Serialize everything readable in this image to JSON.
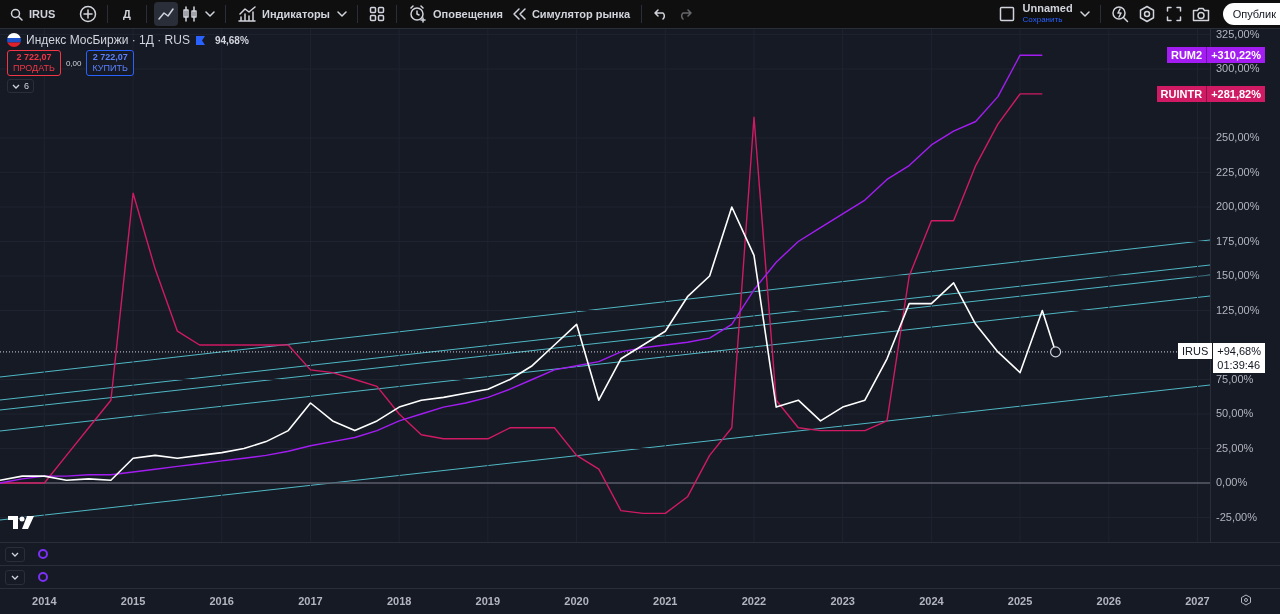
{
  "toolbar": {
    "symbol": "IRUS",
    "interval": "Д",
    "chart_styles": [
      {
        "kind": "line",
        "selected": true
      },
      {
        "kind": "candles",
        "selected": false
      }
    ],
    "buttons": [
      {
        "kind": "indicators",
        "label": "Индикаторы"
      },
      {
        "kind": "templates"
      },
      {
        "kind": "alerts",
        "label": "Оповещения"
      },
      {
        "kind": "replay",
        "label": "Симулятор рынка"
      }
    ],
    "layout": {
      "name": "Unnamed",
      "status": "Сохранить"
    },
    "publish_label": "Опублик"
  },
  "legend": {
    "title": "Индекс МосБиржи · 1Д · RUS",
    "change": "94,68%",
    "sell": {
      "price": "2 722,07",
      "label": "ПРОДАТЬ"
    },
    "spread": "0,00",
    "buy": {
      "price": "2 722,07",
      "label": "КУПИТЬ"
    },
    "indicators_count": "6"
  },
  "chart": {
    "chart_data": {
      "type": "line",
      "x": [
        2013.5,
        2013.75,
        2014,
        2014.25,
        2014.5,
        2014.75,
        2015,
        2015.25,
        2015.5,
        2015.75,
        2016,
        2016.25,
        2016.5,
        2016.75,
        2017,
        2017.25,
        2017.5,
        2017.75,
        2018,
        2018.25,
        2018.5,
        2018.75,
        2019,
        2019.25,
        2019.5,
        2019.75,
        2020,
        2020.25,
        2020.5,
        2020.75,
        2021,
        2021.25,
        2021.5,
        2021.75,
        2022,
        2022.25,
        2022.5,
        2022.75,
        2023,
        2023.25,
        2023.5,
        2023.75,
        2024,
        2024.25,
        2024.5,
        2024.75,
        2025,
        2025.25,
        2025.4
      ],
      "series": [
        {
          "name": "IRUS",
          "color": "#ffffff",
          "values": [
            2,
            5,
            5,
            2,
            3,
            2,
            18,
            20,
            18,
            20,
            22,
            25,
            30,
            38,
            58,
            45,
            38,
            45,
            55,
            60,
            62,
            65,
            68,
            75,
            85,
            100,
            115,
            60,
            90,
            100,
            110,
            135,
            150,
            200,
            165,
            55,
            60,
            45,
            55,
            60,
            90,
            130,
            130,
            145,
            115,
            95,
            80,
            125,
            95
          ]
        },
        {
          "name": "RUM2",
          "color": "#a31df2",
          "values": [
            0,
            3,
            5,
            5,
            6,
            6,
            8,
            10,
            12,
            14,
            16,
            18,
            20,
            23,
            27,
            30,
            33,
            38,
            45,
            50,
            55,
            58,
            62,
            68,
            75,
            82,
            85,
            88,
            95,
            98,
            100,
            102,
            105,
            115,
            140,
            160,
            175,
            185,
            195,
            205,
            220,
            230,
            245,
            255,
            262,
            280,
            310,
            310,
            null
          ]
        },
        {
          "name": "RUINTR",
          "color": "#d01a63",
          "values": [
            0,
            0,
            0,
            20,
            40,
            60,
            210,
            155,
            110,
            100,
            100,
            100,
            100,
            100,
            82,
            80,
            75,
            70,
            50,
            35,
            32,
            32,
            32,
            40,
            40,
            40,
            20,
            10,
            -20,
            -22,
            -22,
            -10,
            20,
            40,
            265,
            60,
            40,
            38,
            38,
            38,
            45,
            150,
            190,
            190,
            230,
            260,
            282,
            282,
            null
          ]
        }
      ],
      "grid": true,
      "xlim": [
        2013.5,
        2027.93
      ],
      "ylim": [
        -42.75,
        329
      ],
      "xticks": [
        2014,
        2015,
        2016,
        2017,
        2018,
        2019,
        2020,
        2021,
        2022,
        2023,
        2024,
        2025,
        2026,
        2027
      ],
      "yticks": [
        {
          "value": 325,
          "label": "325,00%"
        },
        {
          "value": 300,
          "label": "300,00%"
        },
        {
          "value": 250,
          "label": "250,00%"
        },
        {
          "value": 225,
          "label": "225,00%"
        },
        {
          "value": 200,
          "label": "200,00%"
        },
        {
          "value": 175,
          "label": "175,00%"
        },
        {
          "value": 150,
          "label": "150,00%"
        },
        {
          "value": 125,
          "label": "125,00%"
        },
        {
          "value": 75,
          "label": "75,00%"
        },
        {
          "value": 50,
          "label": "50,00%"
        },
        {
          "value": 25,
          "label": "25,00%"
        },
        {
          "value": 0,
          "label": "0,00%"
        },
        {
          "value": -25,
          "label": "-25,00%"
        }
      ]
    },
    "price_labels": [
      {
        "value": "+310,22%",
        "color": "#a31df2"
      },
      {
        "value": "+281,82%",
        "color": "#d01a63"
      }
    ],
    "last_price": {
      "value": "+94,68%",
      "countdown": "01:39:46"
    }
  }
}
